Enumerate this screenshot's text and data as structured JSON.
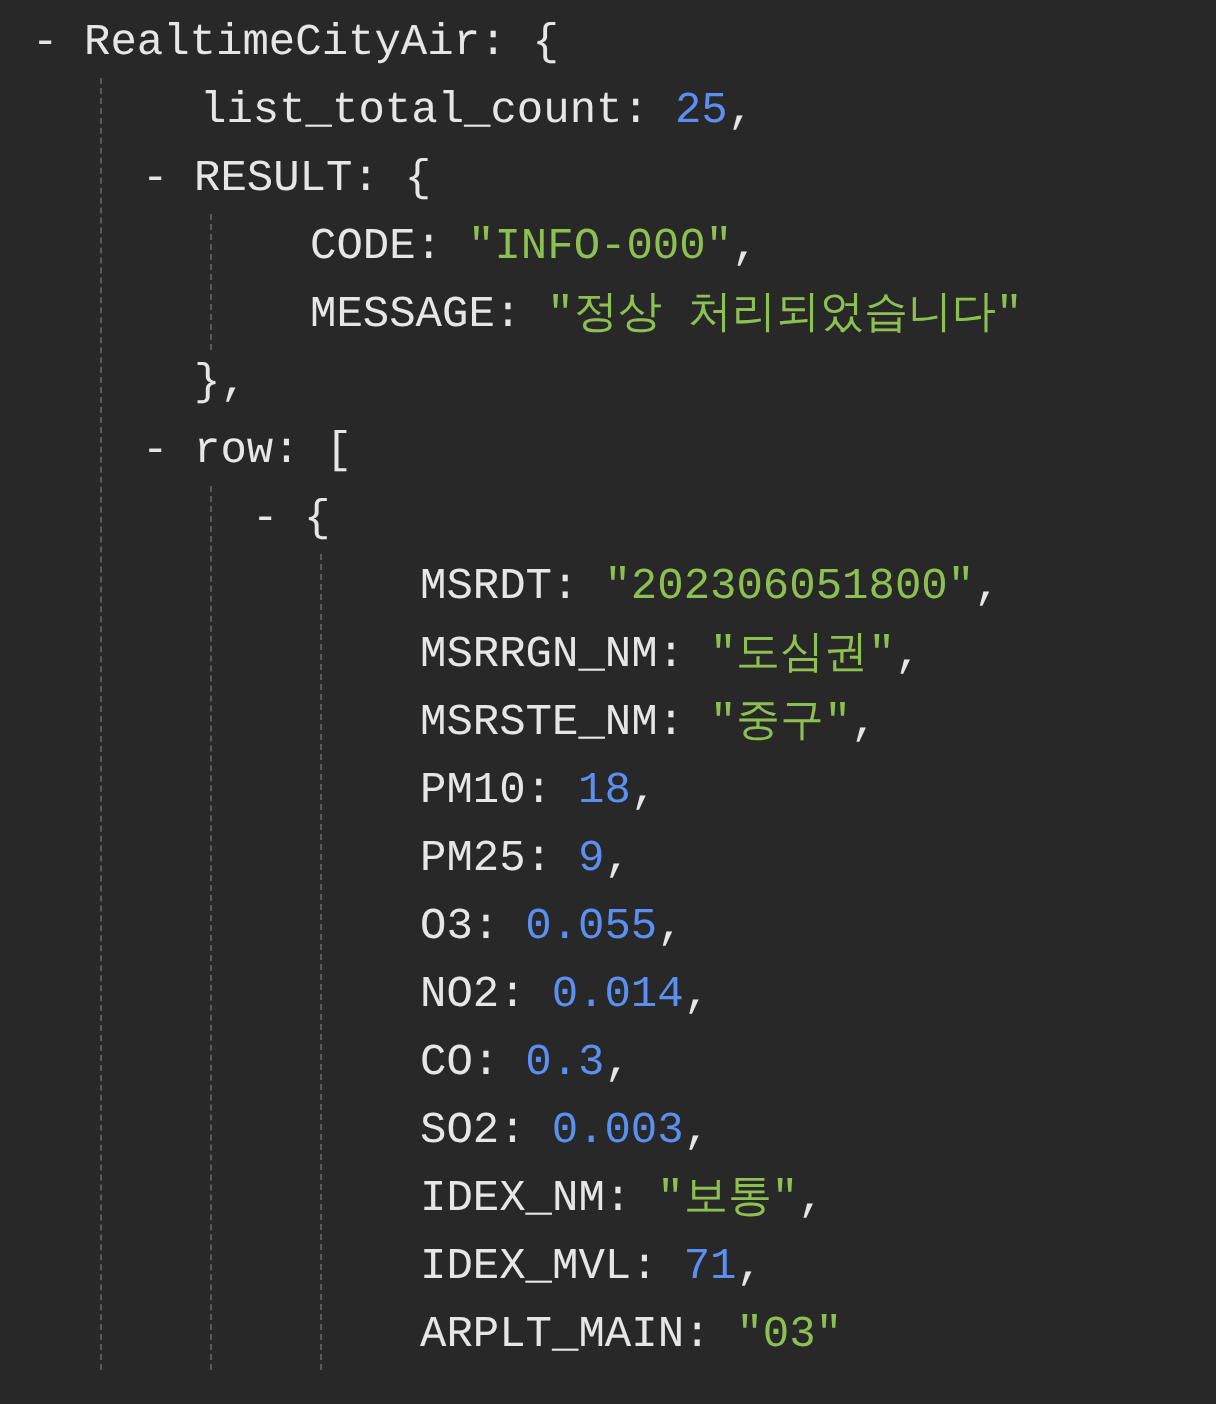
{
  "tree": [
    {
      "toggle": "-",
      "key": "RealtimeCityAir:",
      "open": "{",
      "children": [
        {
          "key": "list_total_count:",
          "value": "25",
          "kind": "number",
          "trail": ","
        },
        {
          "toggle": "-",
          "key": "RESULT:",
          "open": "{",
          "close": "},",
          "children": [
            {
              "key": "CODE:",
              "value": "\"INFO-000\"",
              "kind": "string",
              "trail": ","
            },
            {
              "key": "MESSAGE:",
              "value": "\"정상 처리되었습니다\"",
              "kind": "string"
            }
          ]
        },
        {
          "toggle": "-",
          "key": "row:",
          "open": "[",
          "children": [
            {
              "toggle": "-",
              "open": "{",
              "children": [
                {
                  "key": "MSRDT:",
                  "value": "\"202306051800\"",
                  "kind": "string",
                  "trail": ","
                },
                {
                  "key": "MSRRGN_NM:",
                  "value": "\"도심권\"",
                  "kind": "string",
                  "trail": ","
                },
                {
                  "key": "MSRSTE_NM:",
                  "value": "\"중구\"",
                  "kind": "string",
                  "trail": ","
                },
                {
                  "key": "PM10:",
                  "value": "18",
                  "kind": "number",
                  "trail": ","
                },
                {
                  "key": "PM25:",
                  "value": "9",
                  "kind": "number",
                  "trail": ","
                },
                {
                  "key": "O3:",
                  "value": "0.055",
                  "kind": "number",
                  "trail": ","
                },
                {
                  "key": "NO2:",
                  "value": "0.014",
                  "kind": "number",
                  "trail": ","
                },
                {
                  "key": "CO:",
                  "value": "0.3",
                  "kind": "number",
                  "trail": ","
                },
                {
                  "key": "SO2:",
                  "value": "0.003",
                  "kind": "number",
                  "trail": ","
                },
                {
                  "key": "IDEX_NM:",
                  "value": "\"보통\"",
                  "kind": "string",
                  "trail": ","
                },
                {
                  "key": "IDEX_MVL:",
                  "value": "71",
                  "kind": "number",
                  "trail": ","
                },
                {
                  "key": "ARPLT_MAIN:",
                  "value": "\"03\"",
                  "kind": "string"
                }
              ]
            }
          ]
        }
      ]
    }
  ]
}
